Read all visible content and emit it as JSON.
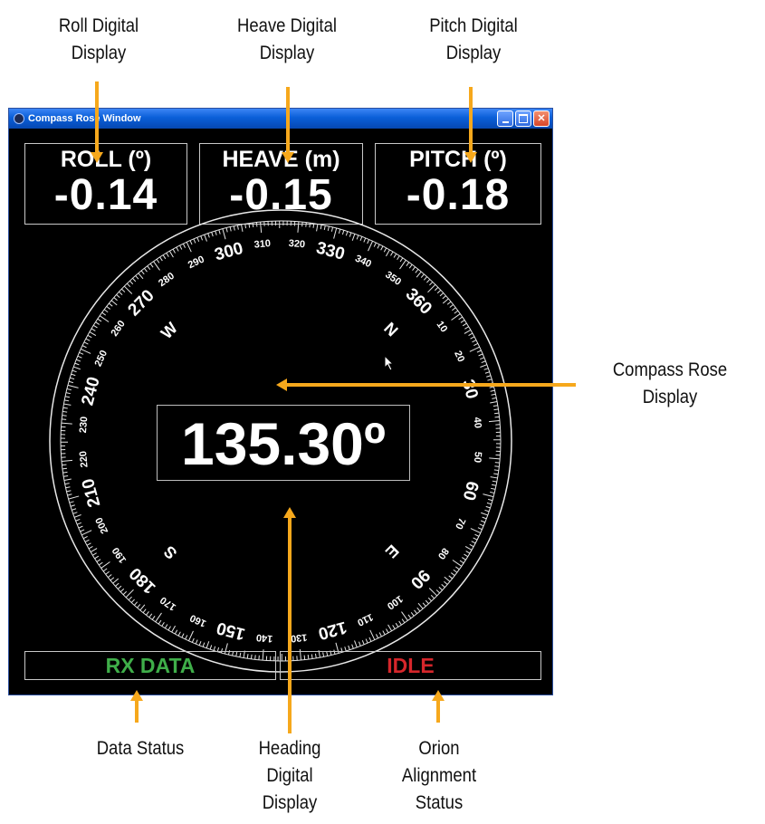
{
  "callouts": {
    "roll": "Roll Digital\nDisplay",
    "heave": "Heave Digital\nDisplay",
    "pitch": "Pitch Digital\nDisplay",
    "compass": "Compass Rose\nDisplay",
    "data_status": "Data Status",
    "heading": "Heading\nDigital\nDisplay",
    "orion": "Orion\nAlignment\nStatus"
  },
  "window": {
    "title": "Compass Rose Window",
    "icons": {
      "app": "app-icon",
      "minimize": "minimize-icon",
      "maximize": "maximize-icon",
      "close": "close-icon"
    }
  },
  "readouts": {
    "roll": {
      "label": "ROLL (º)",
      "value": "-0.14"
    },
    "heave": {
      "label": "HEAVE (m)",
      "value": "-0.15"
    },
    "pitch": {
      "label": "PITCH (º)",
      "value": "-0.18"
    }
  },
  "compass": {
    "heading_value": 135.3,
    "heading_text": "135.30º",
    "major_labels": [
      "360",
      "30",
      "60",
      "90",
      "120",
      "150",
      "180",
      "210",
      "240",
      "270",
      "300",
      "330"
    ],
    "minor_labels": [
      "10",
      "20",
      "40",
      "50",
      "70",
      "80",
      "100",
      "110",
      "130",
      "140",
      "160",
      "170",
      "190",
      "200",
      "220",
      "230",
      "250",
      "260",
      "280",
      "290",
      "310",
      "320",
      "340",
      "350"
    ],
    "cardinals": {
      "N": "N",
      "E": "E",
      "S": "S",
      "W": "W"
    }
  },
  "status": {
    "data": {
      "text": "RX DATA",
      "color": "#3fae49"
    },
    "alignment": {
      "text": "IDLE",
      "color": "#d6262b"
    }
  },
  "colors": {
    "arrow": "#f6a81c",
    "window_border": "#2b4f9e",
    "titlebar": "#0a5fd8"
  }
}
